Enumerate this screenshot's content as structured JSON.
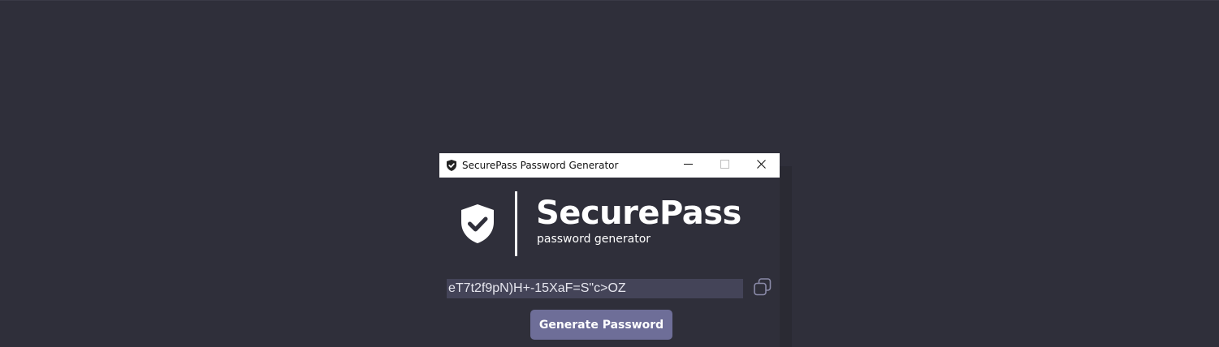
{
  "window": {
    "title": "SecurePass Password Generator",
    "controls": {
      "minimize_icon": "minimize-icon",
      "maximize_icon": "maximize-icon",
      "close_icon": "close-icon"
    }
  },
  "header": {
    "brand_name": "SecurePass",
    "subtitle": "password generator",
    "logo_icon": "shield-check-icon"
  },
  "password": {
    "value": "eT7t2f9pN)H+-15XaF=S\"c>OZ",
    "copy_icon": "copy-icon"
  },
  "actions": {
    "generate_label": "Generate Password"
  },
  "colors": {
    "background": "#2f2f3a",
    "field_background": "#444458",
    "button_background": "#6e6e98",
    "text": "#ffffff"
  }
}
